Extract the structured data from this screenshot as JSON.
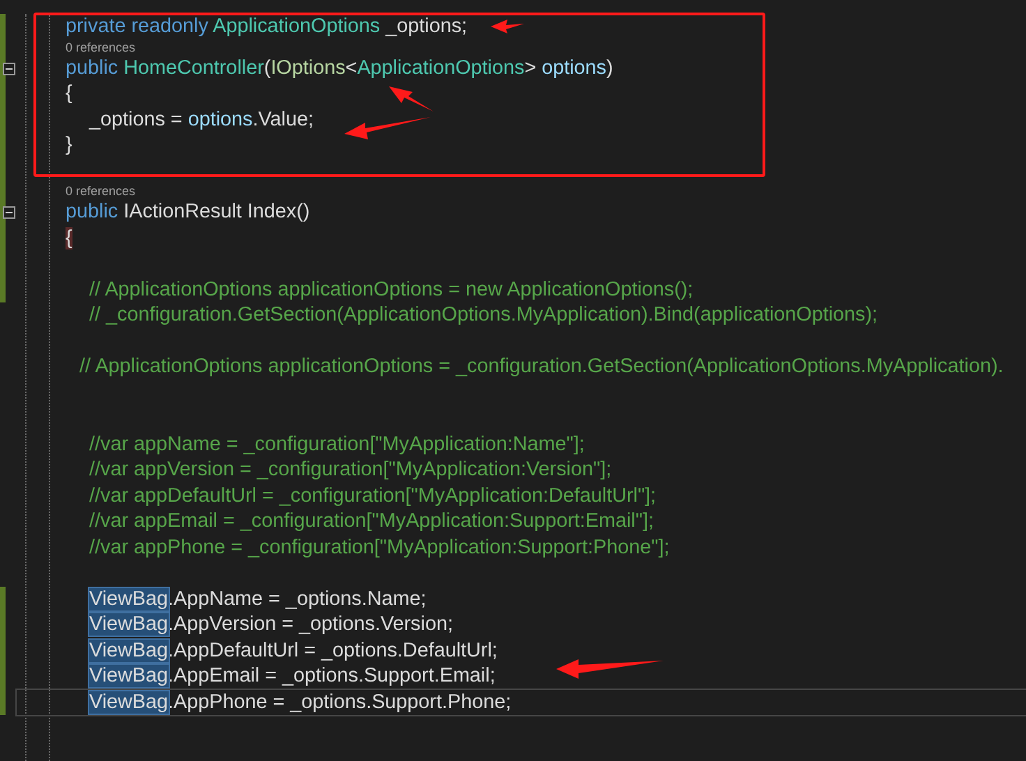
{
  "editor": {
    "lines": [
      {
        "kind": "member",
        "collapsible": false,
        "current": false,
        "tokens": [
          {
            "text": "private readonly ",
            "kind": "keyword"
          },
          {
            "text": "ApplicationOptions",
            "kind": "class"
          },
          {
            "text": " _options;",
            "kind": "plain"
          }
        ]
      },
      {
        "kind": "codelens",
        "text": "0 references"
      },
      {
        "kind": "member",
        "collapsible": true,
        "current": false,
        "tokens": [
          {
            "text": "public ",
            "kind": "keyword"
          },
          {
            "text": "HomeController",
            "kind": "class"
          },
          {
            "text": "(",
            "kind": "plain"
          },
          {
            "text": "IOptions",
            "kind": "interface"
          },
          {
            "text": "<",
            "kind": "plain"
          },
          {
            "text": "ApplicationOptions",
            "kind": "class"
          },
          {
            "text": "> ",
            "kind": "plain"
          },
          {
            "text": "options",
            "kind": "param"
          },
          {
            "text": ")",
            "kind": "plain"
          }
        ]
      },
      {
        "kind": "member",
        "collapsible": false,
        "current": false,
        "tokens": [
          {
            "text": "{",
            "kind": "plain"
          }
        ]
      },
      {
        "kind": "body",
        "collapsible": false,
        "current": false,
        "tokens": [
          {
            "text": "_options = ",
            "kind": "plain"
          },
          {
            "text": "options",
            "kind": "param"
          },
          {
            "text": ".Value;",
            "kind": "plain"
          }
        ]
      },
      {
        "kind": "member",
        "collapsible": false,
        "current": false,
        "tokens": [
          {
            "text": "}",
            "kind": "plain"
          }
        ]
      },
      {
        "kind": "blank"
      },
      {
        "kind": "codelens",
        "text": "0 references"
      },
      {
        "kind": "member",
        "collapsible": true,
        "current": false,
        "tokens": [
          {
            "text": "public ",
            "kind": "keyword"
          },
          {
            "text": "IActionResult Index()",
            "kind": "plain"
          }
        ]
      },
      {
        "kind": "member",
        "collapsible": false,
        "current": false,
        "tokens": [
          {
            "text": "{",
            "kind": "brace-match"
          }
        ]
      },
      {
        "kind": "blank"
      },
      {
        "kind": "body",
        "collapsible": false,
        "current": false,
        "tokens": [
          {
            "text": "// ApplicationOptions applicationOptions = new ApplicationOptions();",
            "kind": "comment"
          }
        ]
      },
      {
        "kind": "body",
        "collapsible": false,
        "current": false,
        "tokens": [
          {
            "text": "// _configuration.GetSection(ApplicationOptions.MyApplication).Bind(applicationOptions);",
            "kind": "comment"
          }
        ]
      },
      {
        "kind": "blank"
      },
      {
        "kind": "body-outdented",
        "collapsible": false,
        "current": false,
        "tokens": [
          {
            "text": "// ApplicationOptions applicationOptions = _configuration.GetSection(ApplicationOptions.MyApplication).",
            "kind": "comment"
          }
        ]
      },
      {
        "kind": "blank"
      },
      {
        "kind": "blank"
      },
      {
        "kind": "body",
        "collapsible": false,
        "current": false,
        "tokens": [
          {
            "text": "//var appName = _configuration[\"MyApplication:Name\"];",
            "kind": "comment"
          }
        ]
      },
      {
        "kind": "body",
        "collapsible": false,
        "current": false,
        "tokens": [
          {
            "text": "//var appVersion = _configuration[\"MyApplication:Version\"];",
            "kind": "comment"
          }
        ]
      },
      {
        "kind": "body",
        "collapsible": false,
        "current": false,
        "tokens": [
          {
            "text": "//var appDefaultUrl = _configuration[\"MyApplication:DefaultUrl\"];",
            "kind": "comment"
          }
        ]
      },
      {
        "kind": "body",
        "collapsible": false,
        "current": false,
        "tokens": [
          {
            "text": "//var appEmail = _configuration[\"MyApplication:Support:Email\"];",
            "kind": "comment"
          }
        ]
      },
      {
        "kind": "body",
        "collapsible": false,
        "current": false,
        "tokens": [
          {
            "text": "//var appPhone = _configuration[\"MyApplication:Support:Phone\"];",
            "kind": "comment"
          }
        ]
      },
      {
        "kind": "blank"
      },
      {
        "kind": "body",
        "collapsible": false,
        "current": false,
        "tokens": [
          {
            "text": "ViewBag",
            "kind": "highlighted"
          },
          {
            "text": ".AppName = _options.Name;",
            "kind": "plain"
          }
        ]
      },
      {
        "kind": "body",
        "collapsible": false,
        "current": false,
        "tokens": [
          {
            "text": "ViewBag",
            "kind": "highlighted"
          },
          {
            "text": ".AppVersion = _options.Version;",
            "kind": "plain"
          }
        ]
      },
      {
        "kind": "body",
        "collapsible": false,
        "current": false,
        "tokens": [
          {
            "text": "ViewBag",
            "kind": "highlighted"
          },
          {
            "text": ".AppDefaultUrl = _options.DefaultUrl;",
            "kind": "plain"
          }
        ]
      },
      {
        "kind": "body",
        "collapsible": false,
        "current": false,
        "tokens": [
          {
            "text": "ViewBag",
            "kind": "highlighted"
          },
          {
            "text": ".AppEmail = _options.Support.Email;",
            "kind": "plain"
          }
        ]
      },
      {
        "kind": "body",
        "collapsible": false,
        "current": true,
        "tokens": [
          {
            "text": "ViewBag",
            "kind": "highlighted"
          },
          {
            "text": ".AppPhone = _options.Support.Phone;",
            "kind": "plain"
          }
        ]
      }
    ]
  }
}
